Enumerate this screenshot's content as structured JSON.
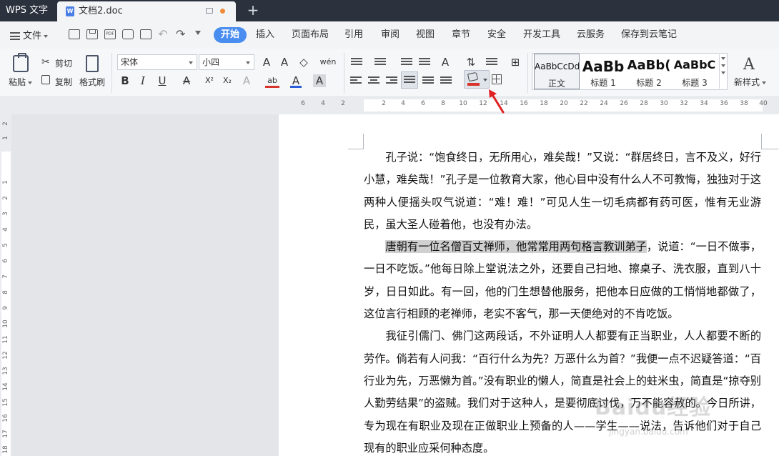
{
  "titlebar": {
    "app_name": "WPS 文字",
    "doc_title": "文档2.doc",
    "new_tab": "+"
  },
  "menubar": {
    "file": "文件",
    "items": [
      "开始",
      "插入",
      "页面布局",
      "引用",
      "审阅",
      "视图",
      "章节",
      "安全",
      "开发工具",
      "云服务",
      "保存到云笔记"
    ],
    "active": "开始"
  },
  "ribbon": {
    "paste": "粘贴",
    "cut": "剪切",
    "copy": "复制",
    "format_painter": "格式刷",
    "font_name": "宋体",
    "font_size": "小四",
    "grow_font": "A",
    "shrink_font": "A",
    "pinyin": "wén",
    "bold": "B",
    "italic": "I",
    "underline": "U",
    "strike": "A",
    "superscript": "X²",
    "subscript": "X₂",
    "text_effect": "A",
    "highlight": "ab",
    "font_color": "A",
    "char_shading": "A",
    "styles": [
      {
        "preview": "AaBbCcDd",
        "name": "正文"
      },
      {
        "preview": "AaBb",
        "name": "标题 1"
      },
      {
        "preview": "AaBb(",
        "name": "标题 2"
      },
      {
        "preview": "AaBbC",
        "name": "标题 3"
      }
    ],
    "new_style": "新样式"
  },
  "ruler": {
    "h_ticks": [
      "6",
      "4",
      "2",
      "2",
      "4",
      "6",
      "8",
      "10",
      "12",
      "14",
      "16",
      "18",
      "20",
      "22",
      "24",
      "26",
      "28",
      "30",
      "32",
      "34",
      "36",
      "38",
      "40"
    ],
    "v_ticks": [
      "2",
      "1",
      "1",
      "2",
      "3",
      "4",
      "5",
      "6",
      "7",
      "8",
      "9",
      "10",
      "11",
      "12",
      "13",
      "14",
      "15",
      "16",
      "17",
      "18"
    ]
  },
  "document": {
    "p1": "孔子说：“饱食终日，无所用心，难矣哉！”又说：“群居终日，言不及义，好行小慧，难矣哉！”孔子是一位教育大家，他心目中没有什么人不可教悔，独独对于这两种人便摇头叹气说道：“难！难！”可见人生一切毛病都有药可医，惟有无业游民，虽大圣人碰着他，也没有办法。",
    "p2_highlight": "唐朝有一位名僧百丈禅师，他常常用两句格言教训弟子",
    "p2_rest": "，说道：“一日不做事，一日不吃饭。”他每日除上堂说法之外，还要自己扫地、擦桌子、洗衣服，直到八十岁，日日如此。有一回，他的门生想替他服务，把他本日应做的工悄悄地都做了，这位言行相顾的老禅师，老实不客气，那一天便绝对的不肯吃饭。",
    "p3": "我征引儒门、佛门这两段话，不外证明人人都要有正当职业，人人都要不断的劳作。倘若有人问我：“百行什么为先？万恶什么为首？”我便一点不迟疑答道：“百行业为先，万恶懒为首。”没有职业的懒人，简直是社会上的蛀米虫，简直是“掠夺别人勤劳结果”的盗贼。我们对于这种人，是要彻底讨伐，万不能容赦的。今日所讲，专为现在有职业及现在正做职业上预备的人——学生——说法，告诉他们对于自己现有的职业应采何种态度。"
  },
  "watermark": {
    "brand": "Baidu经验",
    "url": "jingyan.baidu.com"
  },
  "colors": {
    "titlebar": "#2b313d",
    "accent": "#4a8df0",
    "shading_red": "#d9342b"
  }
}
